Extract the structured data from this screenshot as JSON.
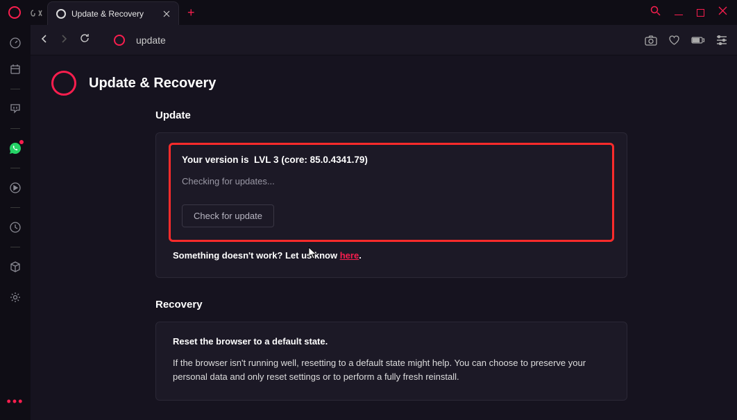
{
  "tab": {
    "title": "Update & Recovery"
  },
  "toolbar": {
    "address": "update"
  },
  "page": {
    "title": "Update & Recovery",
    "update": {
      "heading": "Update",
      "version_prefix": "Your version is",
      "version_level": "LVL 3",
      "version_core": "(core: 85.0.4341.79)",
      "status": "Checking for updates...",
      "check_button": "Check for update",
      "help_prefix": "Something doesn't work? Let us know ",
      "help_link": "here"
    },
    "recovery": {
      "heading": "Recovery",
      "reset_title": "Reset the browser to a default state.",
      "reset_desc": "If the browser isn't running well, resetting to a default state might help. You can choose to preserve your personal data and only reset settings or to perform a fully fresh reinstall."
    }
  }
}
